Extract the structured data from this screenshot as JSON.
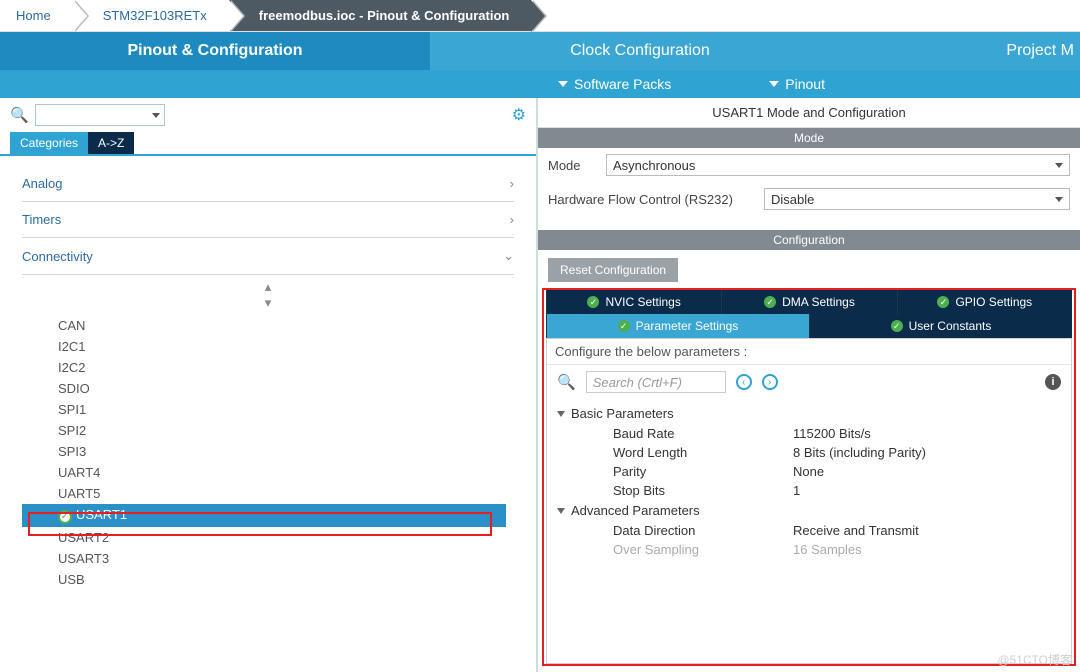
{
  "breadcrumbs": {
    "home": "Home",
    "device": "STM32F103RETx",
    "file": "freemodbus.ioc - Pinout & Configuration"
  },
  "toptabs": {
    "pinout": "Pinout & Configuration",
    "clock": "Clock Configuration",
    "project": "Project M"
  },
  "subbar": {
    "packs": "Software Packs",
    "pinout": "Pinout"
  },
  "left": {
    "filter": {
      "categories": "Categories",
      "az": "A->Z"
    },
    "cats": {
      "analog": "Analog",
      "timers": "Timers",
      "connectivity": "Connectivity"
    },
    "periphs": [
      "CAN",
      "I2C1",
      "I2C2",
      "SDIO",
      "SPI1",
      "SPI2",
      "SPI3",
      "UART4",
      "UART5",
      "USART1",
      "USART2",
      "USART3",
      "USB"
    ],
    "selected": "USART1"
  },
  "right": {
    "title": "USART1 Mode and Configuration",
    "modehdr": "Mode",
    "mode_label": "Mode",
    "mode_value": "Asynchronous",
    "hw_label": "Hardware Flow Control (RS232)",
    "hw_value": "Disable",
    "confighdr": "Configuration",
    "reset": "Reset Configuration",
    "tabs": {
      "nvic": "NVIC Settings",
      "dma": "DMA Settings",
      "gpio": "GPIO Settings",
      "param": "Parameter Settings",
      "user": "User Constants"
    },
    "param_title": "Configure the below parameters :",
    "search_ph": "Search (Crtl+F)",
    "grp_basic": "Basic Parameters",
    "grp_adv": "Advanced Parameters",
    "baud_k": "Baud Rate",
    "baud_v": "115200 Bits/s",
    "word_k": "Word Length",
    "word_v": "8 Bits (including Parity)",
    "parity_k": "Parity",
    "parity_v": "None",
    "stop_k": "Stop Bits",
    "stop_v": "1",
    "dir_k": "Data Direction",
    "dir_v": "Receive and Transmit",
    "ovs_k": "Over Sampling",
    "ovs_v": "16 Samples"
  },
  "watermark": "@51CTO博客"
}
